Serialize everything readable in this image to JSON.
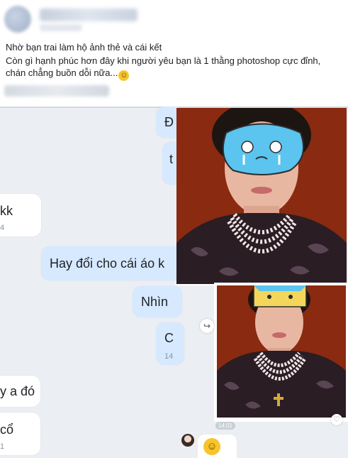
{
  "post": {
    "title": "Nhờ bạn trai làm hộ ảnh thẻ và cái kết",
    "body": "Còn gì hạnh phúc hơn đây khi người yêu bạn là 1 thằng photoshop cực đỉnh, chán chẳng buồn dỗi nữa...",
    "emoji": "☺"
  },
  "chat": {
    "left_messages": [
      {
        "text": "kk",
        "time": "4"
      },
      {
        "text": "y a đó",
        "time": ""
      },
      {
        "text": "cổ",
        "time": "1"
      }
    ],
    "right_messages": [
      {
        "text": "Đ",
        "time": ""
      },
      {
        "text": "t",
        "time": ""
      },
      {
        "text": "Hay đổi cho cái áo k",
        "time": ""
      },
      {
        "text": "Nhìn",
        "time": ""
      },
      {
        "text": "C",
        "time": "14"
      }
    ],
    "photo_time": "14:01",
    "reply_emoji": "☺",
    "share_icon": "↪",
    "heart_icon": "♡"
  },
  "colors": {
    "photo_background": "#8a2a10",
    "bubble_blue": "#d7e9ff",
    "chat_background": "#ebeef2"
  }
}
